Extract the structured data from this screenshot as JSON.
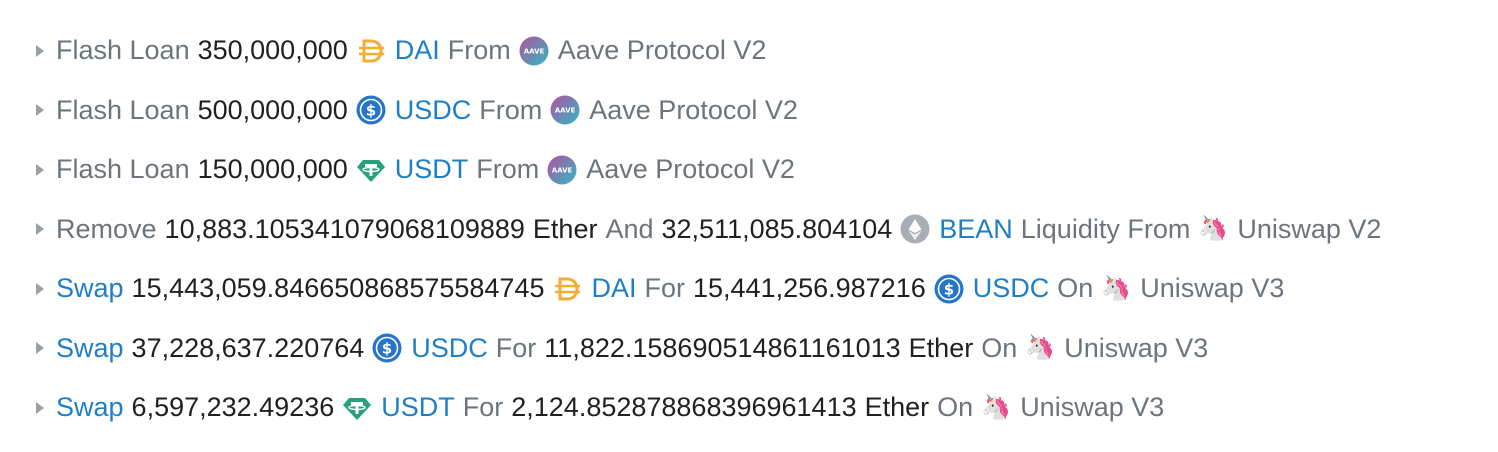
{
  "colors": {
    "link": "#1e7fc7",
    "muted": "#6c757d",
    "text": "#1e2022",
    "dai": "#f5ac37",
    "usdc": "#2775ca",
    "usdt": "#26a17b",
    "aave_start": "#b6509e",
    "aave_end": "#2ebac6",
    "ether": "#a9aeb6"
  },
  "rows": [
    {
      "action": "Flash Loan",
      "amount": "350,000,000",
      "token_icon": "dai-icon",
      "token": "DAI",
      "connector": "From",
      "protocol_icon": "aave-icon",
      "protocol": "Aave Protocol V2"
    },
    {
      "action": "Flash Loan",
      "amount": "500,000,000",
      "token_icon": "usdc-icon",
      "token": "USDC",
      "connector": "From",
      "protocol_icon": "aave-icon",
      "protocol": "Aave Protocol V2"
    },
    {
      "action": "Flash Loan",
      "amount": "150,000,000",
      "token_icon": "usdt-icon",
      "token": "USDT",
      "connector": "From",
      "protocol_icon": "aave-icon",
      "protocol": "Aave Protocol V2"
    },
    {
      "action": "Remove",
      "amount1": "10,883.105341079068109889",
      "token1": "Ether",
      "and": "And",
      "amount2": "32,511,085.804104",
      "token2_icon": "ether-icon",
      "token2": "BEAN",
      "liquidity_from": "Liquidity From",
      "protocol_icon": "unicorn-icon",
      "protocol": "Uniswap V2"
    },
    {
      "action": "Swap",
      "amount_in": "15,443,059.846650868575584745",
      "token_in_icon": "dai-icon",
      "token_in": "DAI",
      "for": "For",
      "amount_out": "15,441,256.987216",
      "token_out_icon": "usdc-icon",
      "token_out": "USDC",
      "on": "On",
      "protocol_icon": "unicorn-icon",
      "protocol": "Uniswap V3"
    },
    {
      "action": "Swap",
      "amount_in": "37,228,637.220764",
      "token_in_icon": "usdc-icon",
      "token_in": "USDC",
      "for": "For",
      "amount_out": "11,822.158690514861161013",
      "token_out": "Ether",
      "on": "On",
      "protocol_icon": "unicorn-icon",
      "protocol": "Uniswap V3"
    },
    {
      "action": "Swap",
      "amount_in": "6,597,232.49236",
      "token_in_icon": "usdt-icon",
      "token_in": "USDT",
      "for": "For",
      "amount_out": "2,124.852878868396961413",
      "token_out": "Ether",
      "on": "On",
      "protocol_icon": "unicorn-icon",
      "protocol": "Uniswap V3"
    }
  ]
}
